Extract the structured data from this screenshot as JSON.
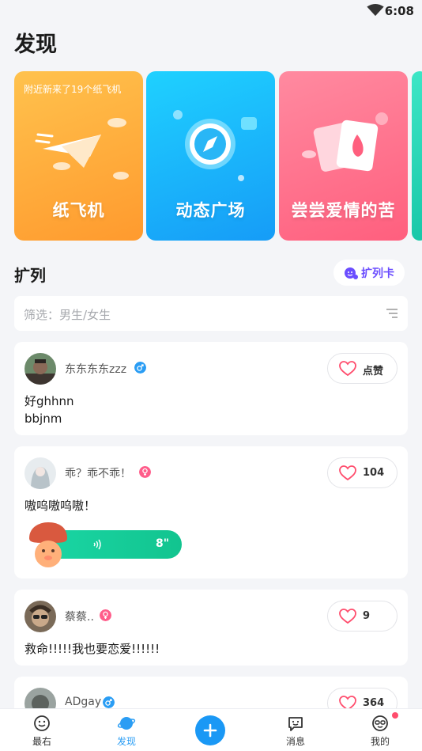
{
  "status": {
    "time": "6:08"
  },
  "page_title": "发现",
  "cards": [
    {
      "subtitle": "附近新来了19个纸飞机",
      "title": "纸飞机"
    },
    {
      "subtitle": "",
      "title": "动态广场"
    },
    {
      "subtitle": "",
      "title": "尝尝爱情的苦"
    }
  ],
  "section": {
    "title": "扩列",
    "expand_card_label": "扩列卡"
  },
  "filter": {
    "placeholder": "筛选：男生/女生"
  },
  "posts": [
    {
      "username": "东东东东zzz",
      "gender": "male",
      "like_label": "点赞",
      "text_line1": "好ghhnn",
      "text_line2": "bbjnm"
    },
    {
      "username": "乖？乖不乖！",
      "gender": "female",
      "like_label": "104",
      "text_line1": "嗷呜嗷呜嗷！",
      "voice_duration": "8\""
    },
    {
      "username": "蔡蔡..",
      "gender": "female",
      "like_label": "9",
      "text_line1": "救命!!!!!我也要恋爱!!!!!!"
    },
    {
      "username": "ADgay",
      "gender": "male",
      "like_label": "364"
    }
  ],
  "nav": {
    "items": [
      {
        "label": "最右"
      },
      {
        "label": "发现"
      },
      {
        "label": "消息"
      },
      {
        "label": "我的"
      }
    ]
  },
  "colors": {
    "accent": "#1a98f5",
    "male_badge": "#2a9df4",
    "female_badge": "#ff5c8a",
    "like_heart": "#ff4d6d",
    "voice": "#12c48f"
  }
}
